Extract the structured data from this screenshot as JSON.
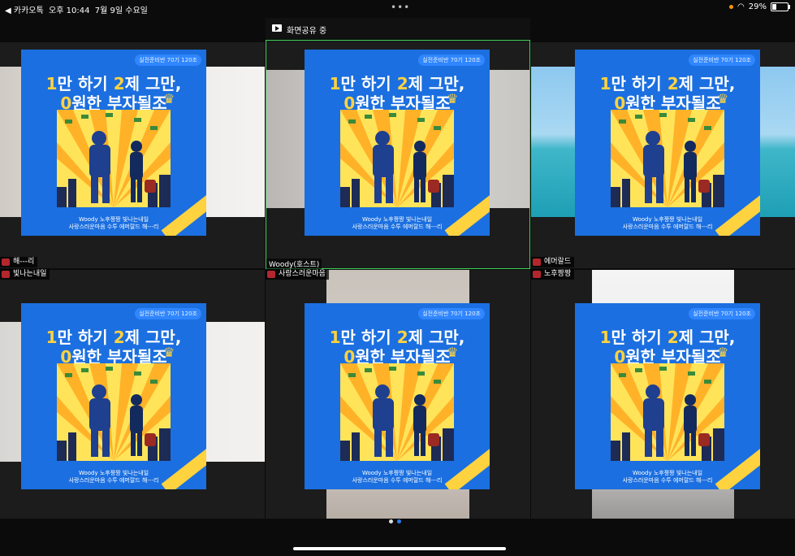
{
  "status": {
    "carrier": "◀ 카카오톡",
    "time": "오후 10:44",
    "date": "7월 9일 수요일",
    "battery": "29%",
    "battery_level": 0.29,
    "dots": "•••"
  },
  "share": {
    "label": "화면공유 중"
  },
  "poster": {
    "tag": "실전준비반 70기 120조",
    "line1_a": "1",
    "line1_b": "만 하기 ",
    "line1_c": "2",
    "line1_d": "제 그만,",
    "line2_a": "0",
    "line2_b": "원한 부자될조",
    "sub1": "Woody 노후짱짱 빛나는내일",
    "sub2": "사랑스러운마음 수투 에머랄드 해---리"
  },
  "participants": {
    "tile1_a": "해---리",
    "tile1_b": "빛나는내일",
    "tile2_host": "Woody(호스트)",
    "tile2_b": "사랑스러운마음",
    "tile3_a": "에머랄드",
    "tile3_b": "노후짱짱"
  },
  "pager": {
    "pages": 2,
    "current": 1
  }
}
